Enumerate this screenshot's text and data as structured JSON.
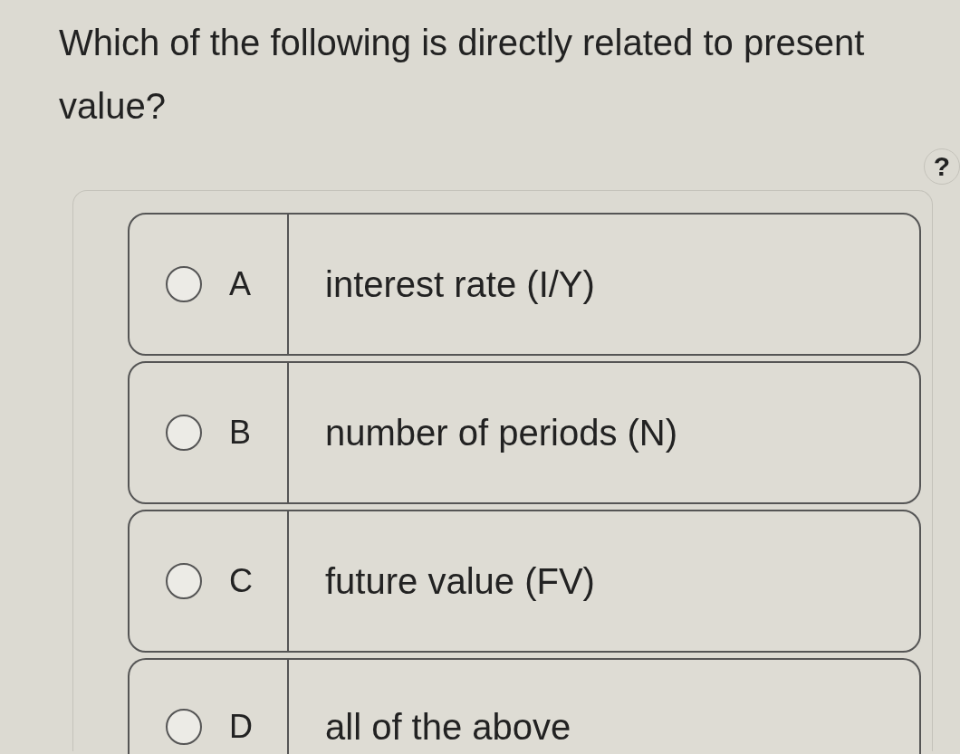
{
  "question": "Which of the following is directly related to present value?",
  "help_button": {
    "label": "?"
  },
  "options": [
    {
      "letter": "A",
      "text": "interest rate (I/Y)",
      "selected": false
    },
    {
      "letter": "B",
      "text": "number of periods (N)",
      "selected": false
    },
    {
      "letter": "C",
      "text": "future value (FV)",
      "selected": false
    },
    {
      "letter": "D",
      "text": "all of the above",
      "selected": false
    }
  ]
}
